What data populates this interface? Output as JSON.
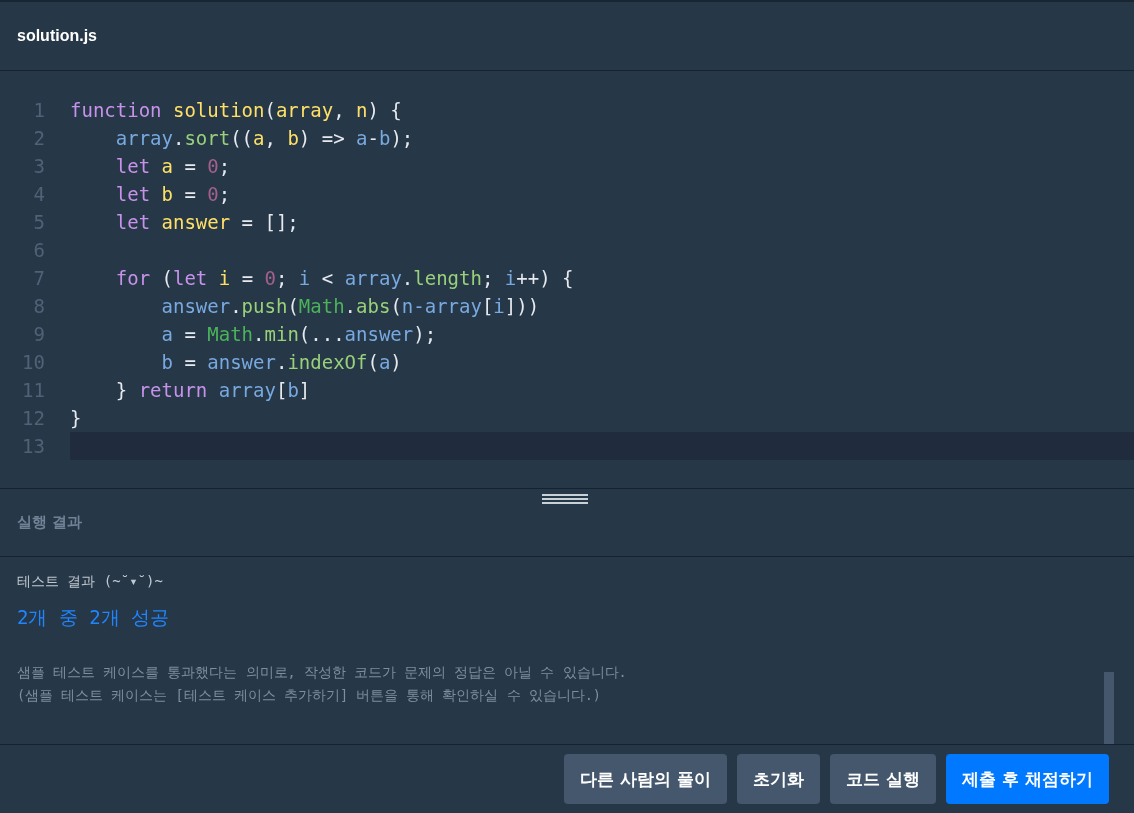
{
  "editor": {
    "filename": "solution.js",
    "lines": [
      {
        "number": "1",
        "active": false,
        "tokens": [
          {
            "kind": "keyword",
            "text": "function "
          },
          {
            "kind": "name",
            "text": "solution"
          },
          {
            "kind": "plain",
            "text": "("
          },
          {
            "kind": "name",
            "text": "array"
          },
          {
            "kind": "plain",
            "text": ", "
          },
          {
            "kind": "name",
            "text": "n"
          },
          {
            "kind": "plain",
            "text": ") {"
          }
        ]
      },
      {
        "number": "2",
        "active": false,
        "tokens": [
          {
            "kind": "variable",
            "text": "    array"
          },
          {
            "kind": "plain",
            "text": "."
          },
          {
            "kind": "method",
            "text": "sort"
          },
          {
            "kind": "plain",
            "text": "(("
          },
          {
            "kind": "name",
            "text": "a"
          },
          {
            "kind": "plain",
            "text": ", "
          },
          {
            "kind": "name",
            "text": "b"
          },
          {
            "kind": "plain",
            "text": ") => "
          },
          {
            "kind": "variable",
            "text": "a"
          },
          {
            "kind": "plain",
            "text": "-"
          },
          {
            "kind": "variable",
            "text": "b"
          },
          {
            "kind": "plain",
            "text": ");"
          }
        ]
      },
      {
        "number": "3",
        "active": false,
        "tokens": [
          {
            "kind": "keyword",
            "text": "    let "
          },
          {
            "kind": "name",
            "text": "a"
          },
          {
            "kind": "plain",
            "text": " = "
          },
          {
            "kind": "number",
            "text": "0"
          },
          {
            "kind": "plain",
            "text": ";"
          }
        ]
      },
      {
        "number": "4",
        "active": false,
        "tokens": [
          {
            "kind": "keyword",
            "text": "    let "
          },
          {
            "kind": "name",
            "text": "b"
          },
          {
            "kind": "plain",
            "text": " = "
          },
          {
            "kind": "number",
            "text": "0"
          },
          {
            "kind": "plain",
            "text": ";"
          }
        ]
      },
      {
        "number": "5",
        "active": false,
        "tokens": [
          {
            "kind": "keyword",
            "text": "    let "
          },
          {
            "kind": "name",
            "text": "answer"
          },
          {
            "kind": "plain",
            "text": " = [];"
          }
        ]
      },
      {
        "number": "6",
        "active": false
      },
      {
        "number": "7",
        "active": false,
        "tokens": [
          {
            "kind": "keyword",
            "text": "    for"
          },
          {
            "kind": "plain",
            "text": " ("
          },
          {
            "kind": "keyword",
            "text": "let "
          },
          {
            "kind": "name",
            "text": "i"
          },
          {
            "kind": "plain",
            "text": " = "
          },
          {
            "kind": "number",
            "text": "0"
          },
          {
            "kind": "plain",
            "text": "; "
          },
          {
            "kind": "variable",
            "text": "i"
          },
          {
            "kind": "plain",
            "text": " < "
          },
          {
            "kind": "variable",
            "text": "array"
          },
          {
            "kind": "plain",
            "text": "."
          },
          {
            "kind": "method",
            "text": "length"
          },
          {
            "kind": "plain",
            "text": "; "
          },
          {
            "kind": "variable",
            "text": "i"
          },
          {
            "kind": "plain",
            "text": "++) {"
          }
        ]
      },
      {
        "number": "8",
        "active": false,
        "tokens": [
          {
            "kind": "variable",
            "text": "        answer"
          },
          {
            "kind": "plain",
            "text": "."
          },
          {
            "kind": "method",
            "text": "push"
          },
          {
            "kind": "plain",
            "text": "("
          },
          {
            "kind": "builtin",
            "text": "Math"
          },
          {
            "kind": "plain",
            "text": "."
          },
          {
            "kind": "method",
            "text": "abs"
          },
          {
            "kind": "plain",
            "text": "("
          },
          {
            "kind": "variable",
            "text": "n-array"
          },
          {
            "kind": "plain",
            "text": "["
          },
          {
            "kind": "variable",
            "text": "i"
          },
          {
            "kind": "plain",
            "text": "]))"
          }
        ]
      },
      {
        "number": "9",
        "active": false,
        "tokens": [
          {
            "kind": "variable",
            "text": "        a"
          },
          {
            "kind": "plain",
            "text": " = "
          },
          {
            "kind": "builtin",
            "text": "Math"
          },
          {
            "kind": "plain",
            "text": "."
          },
          {
            "kind": "method",
            "text": "min"
          },
          {
            "kind": "plain",
            "text": "(..."
          },
          {
            "kind": "variable",
            "text": "answer"
          },
          {
            "kind": "plain",
            "text": ");"
          }
        ]
      },
      {
        "number": "10",
        "active": false,
        "tokens": [
          {
            "kind": "variable",
            "text": "        b"
          },
          {
            "kind": "plain",
            "text": " = "
          },
          {
            "kind": "variable",
            "text": "answer"
          },
          {
            "kind": "plain",
            "text": "."
          },
          {
            "kind": "method",
            "text": "indexOf"
          },
          {
            "kind": "plain",
            "text": "("
          },
          {
            "kind": "variable",
            "text": "a"
          },
          {
            "kind": "plain",
            "text": ")"
          }
        ]
      },
      {
        "number": "11",
        "active": false,
        "tokens": [
          {
            "kind": "plain",
            "text": "    } "
          },
          {
            "kind": "keyword",
            "text": "return "
          },
          {
            "kind": "variable",
            "text": "array"
          },
          {
            "kind": "plain",
            "text": "["
          },
          {
            "kind": "variable",
            "text": "b"
          },
          {
            "kind": "plain",
            "text": "]"
          }
        ]
      },
      {
        "number": "12",
        "active": false,
        "tokens": [
          {
            "kind": "plain",
            "text": "}"
          }
        ]
      },
      {
        "number": "13",
        "active": true
      }
    ]
  },
  "results": {
    "title": "실행 결과",
    "heading": "테스트 결과 (~˘▾˘)~",
    "summary": "2개 중 2개 성공",
    "notes": [
      "샘플 테스트 케이스를 통과했다는 의미로, 작성한 코드가 문제의 정답은 아닐 수 있습니다.",
      "(샘플 테스트 케이스는 [테스트 케이스 추가하기] 버튼을 통해 확인하실 수 있습니다.)"
    ]
  },
  "buttons": [
    {
      "label": "다른 사람의 풀이",
      "kind": "secondary"
    },
    {
      "label": "초기화",
      "kind": "secondary"
    },
    {
      "label": "코드 실행",
      "kind": "secondary"
    },
    {
      "label": "제출 후 채점하기",
      "kind": "primary"
    }
  ]
}
